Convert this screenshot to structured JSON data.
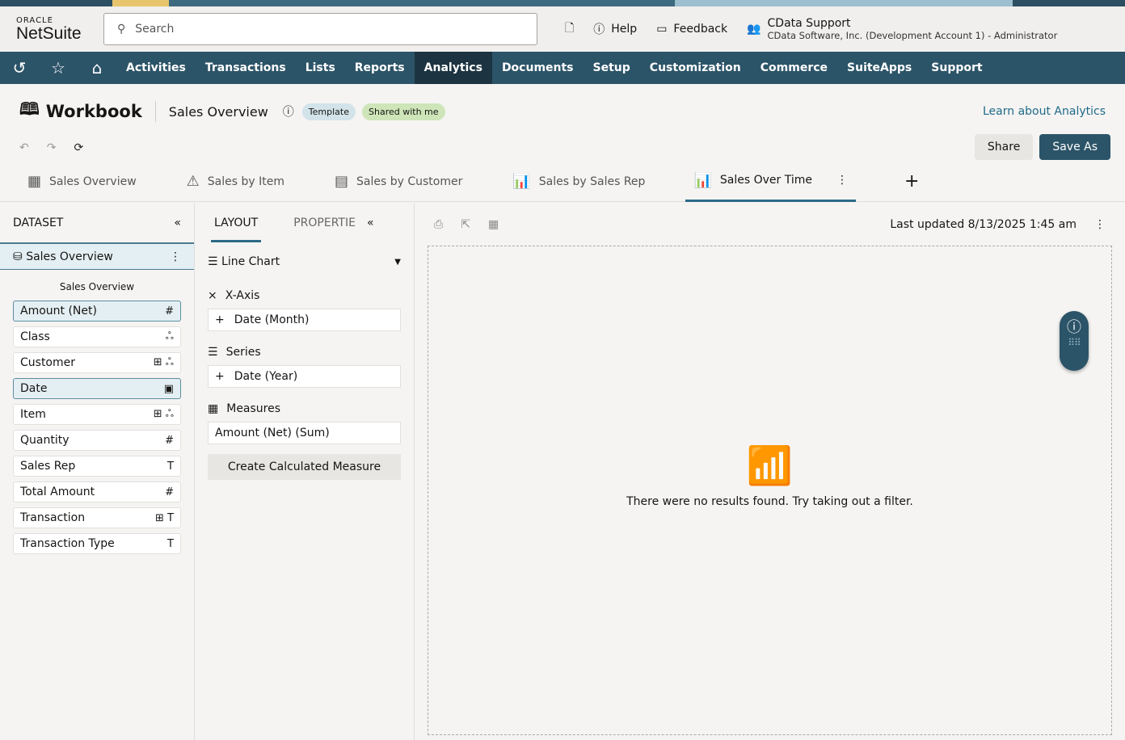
{
  "header": {
    "logo_top": "ORACLE",
    "logo_main": "NetSuite",
    "search_placeholder": "Search",
    "help": "Help",
    "feedback": "Feedback",
    "user_name": "CData Support",
    "user_account": "CData Software, Inc. (Development Account 1) - Administrator"
  },
  "nav": {
    "items": [
      "Activities",
      "Transactions",
      "Lists",
      "Reports",
      "Analytics",
      "Documents",
      "Setup",
      "Customization",
      "Commerce",
      "SuiteApps",
      "Support"
    ],
    "active": "Analytics"
  },
  "workbook": {
    "title": "Workbook",
    "name": "Sales Overview",
    "badge_template": "Template",
    "badge_shared": "Shared with me",
    "learn": "Learn about Analytics",
    "share": "Share",
    "save_as": "Save As"
  },
  "tabs": [
    "Sales Overview",
    "Sales by Item",
    "Sales by Customer",
    "Sales by Sales Rep",
    "Sales Over Time"
  ],
  "dataset": {
    "title": "DATASET",
    "name": "Sales Overview",
    "subtitle": "Sales Overview",
    "fields": [
      {
        "label": "Amount (Net)",
        "icon": "#"
      },
      {
        "label": "Class",
        "icon": "ஃ"
      },
      {
        "label": "Customer",
        "icon": "⊞ ஃ"
      },
      {
        "label": "Date",
        "icon": "▣"
      },
      {
        "label": "Item",
        "icon": "⊞ ஃ"
      },
      {
        "label": "Quantity",
        "icon": "#"
      },
      {
        "label": "Sales Rep",
        "icon": "T"
      },
      {
        "label": "Total Amount",
        "icon": "#"
      },
      {
        "label": "Transaction",
        "icon": "⊞ T"
      },
      {
        "label": "Transaction Type",
        "icon": "T"
      }
    ]
  },
  "layout": {
    "tab_layout": "LAYOUT",
    "tab_properties": "PROPERTIE",
    "chart_type": "Line Chart",
    "xaxis": "X-Axis",
    "xaxis_value": "Date  (Month)",
    "series": "Series",
    "series_value": "Date  (Year)",
    "measures": "Measures",
    "measures_value": "Amount (Net)  (Sum)",
    "create_measure": "Create Calculated Measure"
  },
  "main": {
    "last_updated": "Last updated 8/13/2025 1:45 am",
    "empty": "There were no results found. Try taking out a filter."
  }
}
